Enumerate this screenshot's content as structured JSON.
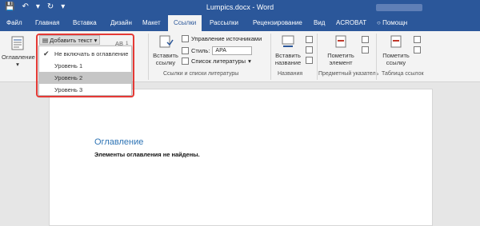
{
  "titlebar": {
    "title": "Lumpics.docx - Word",
    "qat": {
      "save": "💾",
      "undo": "↶",
      "undo_menu": "▾",
      "redo": "↻",
      "customize": "▾"
    }
  },
  "tabs": [
    {
      "label": "Файл"
    },
    {
      "label": "Главная"
    },
    {
      "label": "Вставка"
    },
    {
      "label": "Дизайн"
    },
    {
      "label": "Макет"
    },
    {
      "label": "Ссылки"
    },
    {
      "label": "Рассылки"
    },
    {
      "label": "Рецензирование"
    },
    {
      "label": "Вид"
    },
    {
      "label": "ACROBAT"
    },
    {
      "label": "Помощн"
    }
  ],
  "active_tab": "Ссылки",
  "tell_me_icon": "lightbulb-icon",
  "ribbon": {
    "toc_button": "Оглавление",
    "add_text_button": "Добавить текст",
    "insert_citation_button": "Вставить ссылку",
    "manage_sources": "Управление источниками",
    "style_label": "Стиль:",
    "style_value": "APA",
    "bibliography": "Список литературы",
    "insert_caption_button": "Вставить название",
    "mark_entry_button": "Пометить элемент",
    "mark_citation_button": "Пометить ссылку",
    "group_citations": "Ссылки и списки литературы",
    "group_captions": "Названия",
    "group_index": "Предметный указатель",
    "group_authorities": "Таблица ссылок"
  },
  "dropdown": {
    "items": [
      {
        "label": "Не включать в оглавление",
        "checked": true
      },
      {
        "label": "Уровень 1",
        "checked": false
      },
      {
        "label": "Уровень 2",
        "checked": false,
        "hover": true
      },
      {
        "label": "Уровень 3",
        "checked": false
      }
    ]
  },
  "document": {
    "heading": "Оглавление",
    "message": "Элементы оглавления не найдены."
  },
  "colors": {
    "brand": "#2b579a",
    "highlight": "#e53935",
    "toc_heading": "#2e74b5"
  }
}
